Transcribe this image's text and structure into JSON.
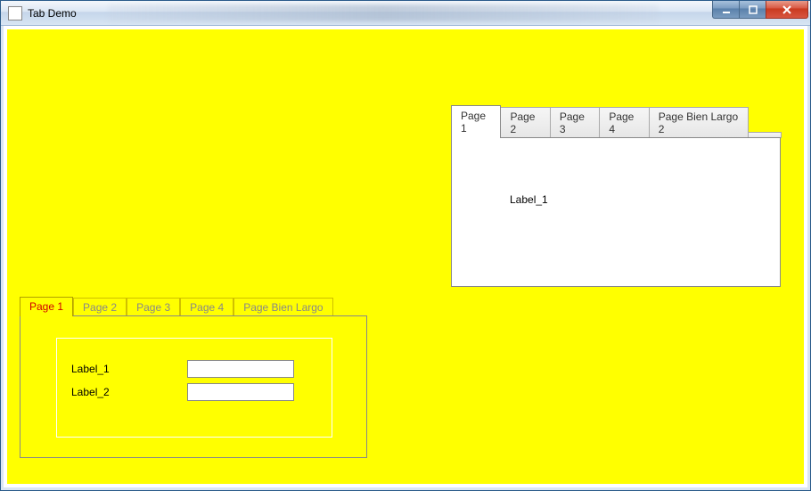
{
  "window": {
    "title": "Tab Demo"
  },
  "right_tabs": {
    "items": [
      {
        "label": "Page 1"
      },
      {
        "label": "Page 2"
      },
      {
        "label": "Page 3"
      },
      {
        "label": "Page 4"
      },
      {
        "label": "Page Bien Largo 2"
      }
    ],
    "active_index": 0,
    "content": {
      "label1": "Label_1"
    }
  },
  "left_tabs": {
    "items": [
      {
        "label": "Page 1"
      },
      {
        "label": "Page 2"
      },
      {
        "label": "Page 3"
      },
      {
        "label": "Page 4"
      },
      {
        "label": "Page Bien Largo"
      }
    ],
    "active_index": 0,
    "content": {
      "row1_label": "Label_1",
      "row1_value": "",
      "row2_label": "Label_2",
      "row2_value": ""
    }
  },
  "colors": {
    "canvas": "#ffff00",
    "active_tab_text_left": "#d00000"
  }
}
